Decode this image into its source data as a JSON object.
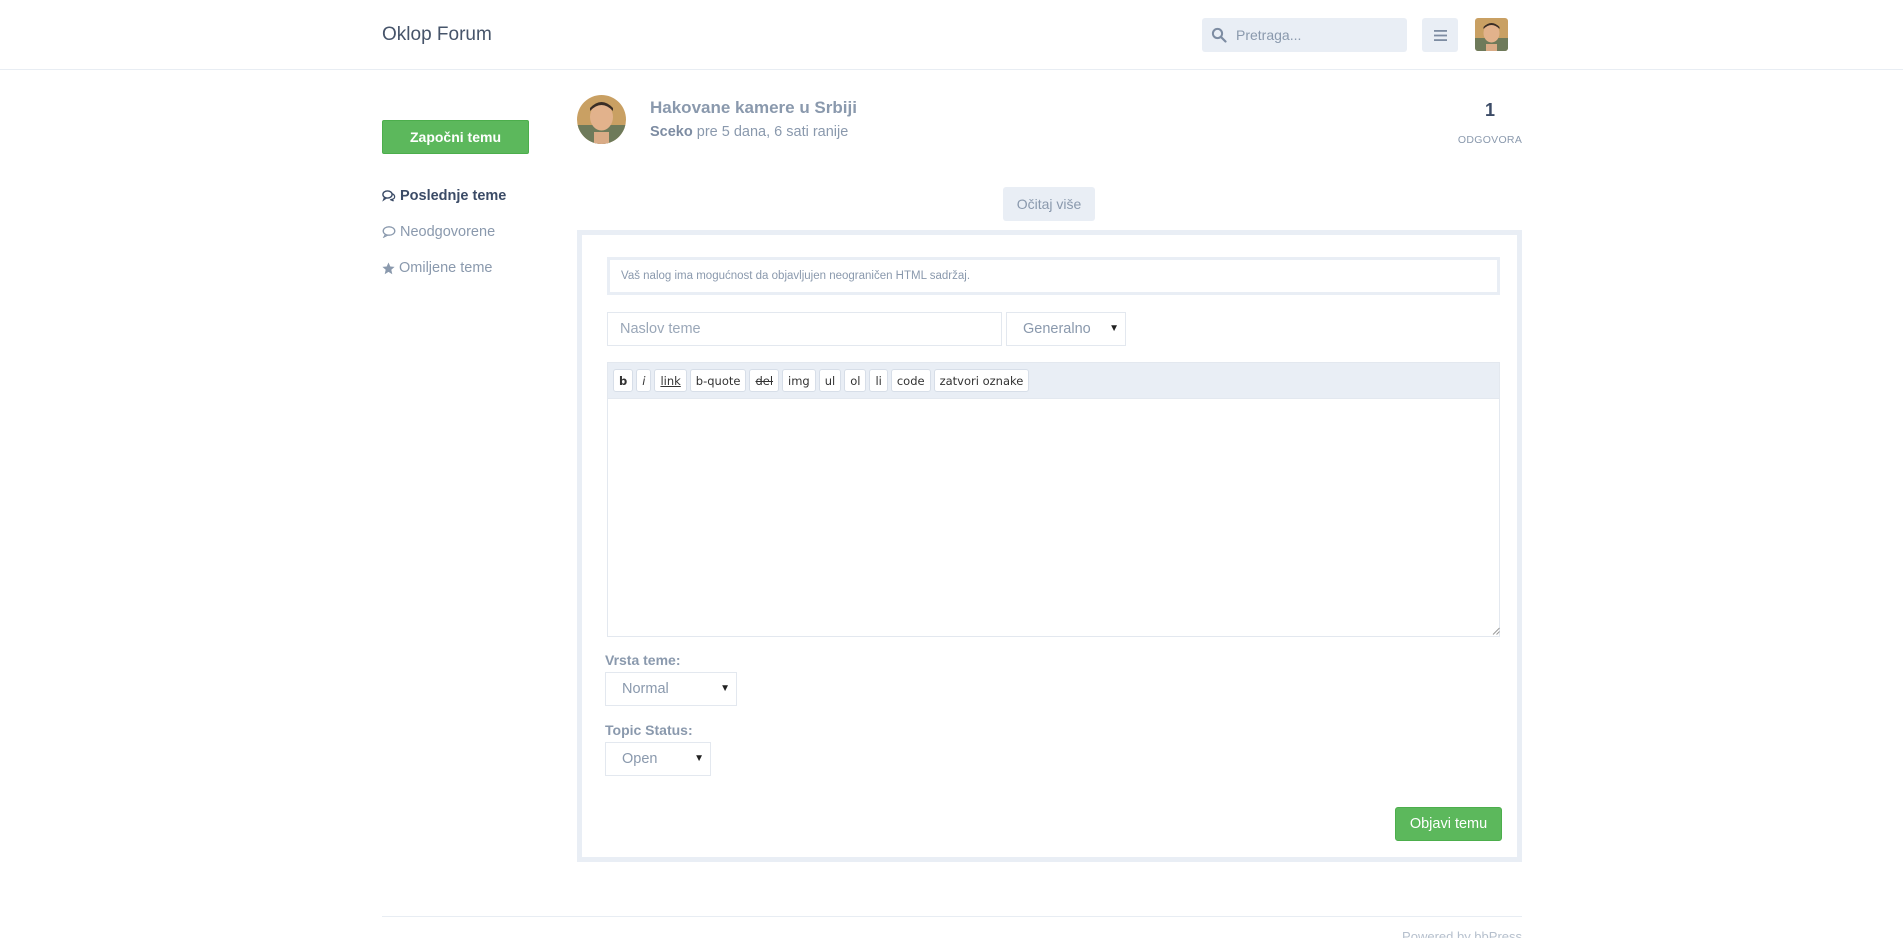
{
  "header": {
    "brand": "Oklop Forum",
    "search_placeholder": "Pretraga..."
  },
  "sidebar": {
    "new_topic_label": "Započni temu",
    "items": [
      {
        "label": "Poslednje teme",
        "icon": "comments-icon",
        "active": true
      },
      {
        "label": "Neodgovorene",
        "icon": "comment-icon",
        "active": false
      },
      {
        "label": "Omiljene teme",
        "icon": "star-icon",
        "active": false
      }
    ]
  },
  "topic": {
    "title": "Hakovane kamere u Srbiji",
    "author": "Sceko",
    "time": "pre 5 dana, 6 sati ranije",
    "reply_count": "1",
    "reply_label": "ODGOVORA"
  },
  "load_more_label": "Očitaj više",
  "form": {
    "notice": "Vaš nalog ima mogućnost da objavljujen neograničen HTML sadržaj.",
    "title_placeholder": "Naslov teme",
    "forum_selected": "Generalno",
    "toolbar_buttons": [
      "b",
      "i",
      "link",
      "b-quote",
      "del",
      "img",
      "ul",
      "ol",
      "li",
      "code",
      "zatvori oznake"
    ],
    "type_label": "Vrsta teme:",
    "type_selected": "Normal",
    "status_label": "Topic Status:",
    "status_selected": "Open",
    "submit_label": "Objavi temu"
  },
  "footer": {
    "powered_by": "Powered by bbPress"
  },
  "colors": {
    "accent_green": "#5cb85c",
    "muted_text": "#8a99ad",
    "panel_border": "#e9eef5"
  }
}
